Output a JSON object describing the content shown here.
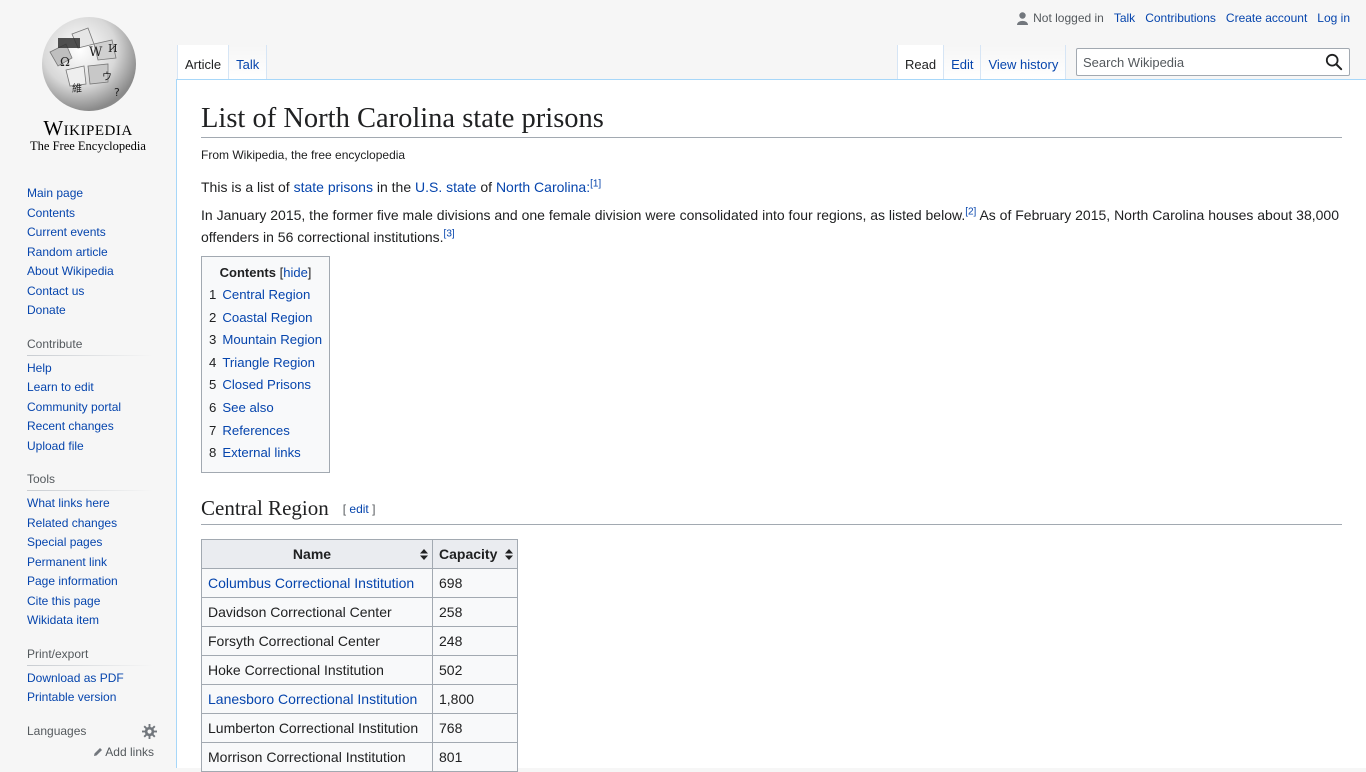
{
  "logo": {
    "wordmark": "Wikipedia",
    "tagline": "The Free Encyclopedia"
  },
  "personal": {
    "not_logged_in": "Not logged in",
    "talk": "Talk",
    "contributions": "Contributions",
    "create_account": "Create account",
    "log_in": "Log in"
  },
  "tabs": {
    "left": [
      {
        "label": "Article",
        "selected": true
      },
      {
        "label": "Talk",
        "selected": false
      }
    ],
    "right": [
      {
        "label": "Read",
        "selected": true
      },
      {
        "label": "Edit",
        "selected": false
      },
      {
        "label": "View history",
        "selected": false
      }
    ]
  },
  "search": {
    "placeholder": "Search Wikipedia"
  },
  "sidebar": {
    "navigation": [
      "Main page",
      "Contents",
      "Current events",
      "Random article",
      "About Wikipedia",
      "Contact us",
      "Donate"
    ],
    "contribute": {
      "title": "Contribute",
      "items": [
        "Help",
        "Learn to edit",
        "Community portal",
        "Recent changes",
        "Upload file"
      ]
    },
    "tools": {
      "title": "Tools",
      "items": [
        "What links here",
        "Related changes",
        "Special pages",
        "Permanent link",
        "Page information",
        "Cite this page",
        "Wikidata item"
      ]
    },
    "print": {
      "title": "Print/export",
      "items": [
        "Download as PDF",
        "Printable version"
      ]
    },
    "languages": {
      "title": "Languages",
      "add_links": "Add links"
    }
  },
  "article": {
    "title": "List of North Carolina state prisons",
    "from": "From Wikipedia, the free encyclopedia",
    "intro": {
      "t1": "This is a list of ",
      "l1": "state prisons",
      "t2": " in the ",
      "l2": "U.S. state",
      "t3": " of ",
      "l3": "North Carolina",
      "t4": ":",
      "ref1": "[1]"
    },
    "para2": {
      "t1": "In January 2015, the former five male divisions and one female division were consolidated into four regions, as listed below.",
      "ref2": "[2]",
      "t2": " As of February 2015, North Carolina houses about 38,000 offenders in 56 correctional institutions.",
      "ref3": "[3]"
    },
    "toc": {
      "title": "Contents",
      "toggle": "hide",
      "items": [
        {
          "num": "1",
          "label": "Central Region"
        },
        {
          "num": "2",
          "label": "Coastal Region"
        },
        {
          "num": "3",
          "label": "Mountain Region"
        },
        {
          "num": "4",
          "label": "Triangle Region"
        },
        {
          "num": "5",
          "label": "Closed Prisons"
        },
        {
          "num": "6",
          "label": "See also"
        },
        {
          "num": "7",
          "label": "References"
        },
        {
          "num": "8",
          "label": "External links"
        }
      ]
    },
    "section1": {
      "title": "Central Region",
      "edit": "edit"
    },
    "table": {
      "headers": [
        "Name",
        "Capacity"
      ],
      "rows": [
        {
          "name": "Columbus Correctional Institution",
          "capacity": "698",
          "link": true
        },
        {
          "name": "Davidson Correctional Center",
          "capacity": "258",
          "link": false
        },
        {
          "name": "Forsyth Correctional Center",
          "capacity": "248",
          "link": false
        },
        {
          "name": "Hoke Correctional Institution",
          "capacity": "502",
          "link": false
        },
        {
          "name": "Lanesboro Correctional Institution",
          "capacity": "1,800",
          "link": true
        },
        {
          "name": "Lumberton Correctional Institution",
          "capacity": "768",
          "link": false
        },
        {
          "name": "Morrison Correctional Institution",
          "capacity": "801",
          "link": false
        }
      ]
    }
  },
  "colors": {
    "link": "#0645ad",
    "text": "#202122",
    "border": "#a2a9b1",
    "tab_border": "#a7d7f9"
  }
}
